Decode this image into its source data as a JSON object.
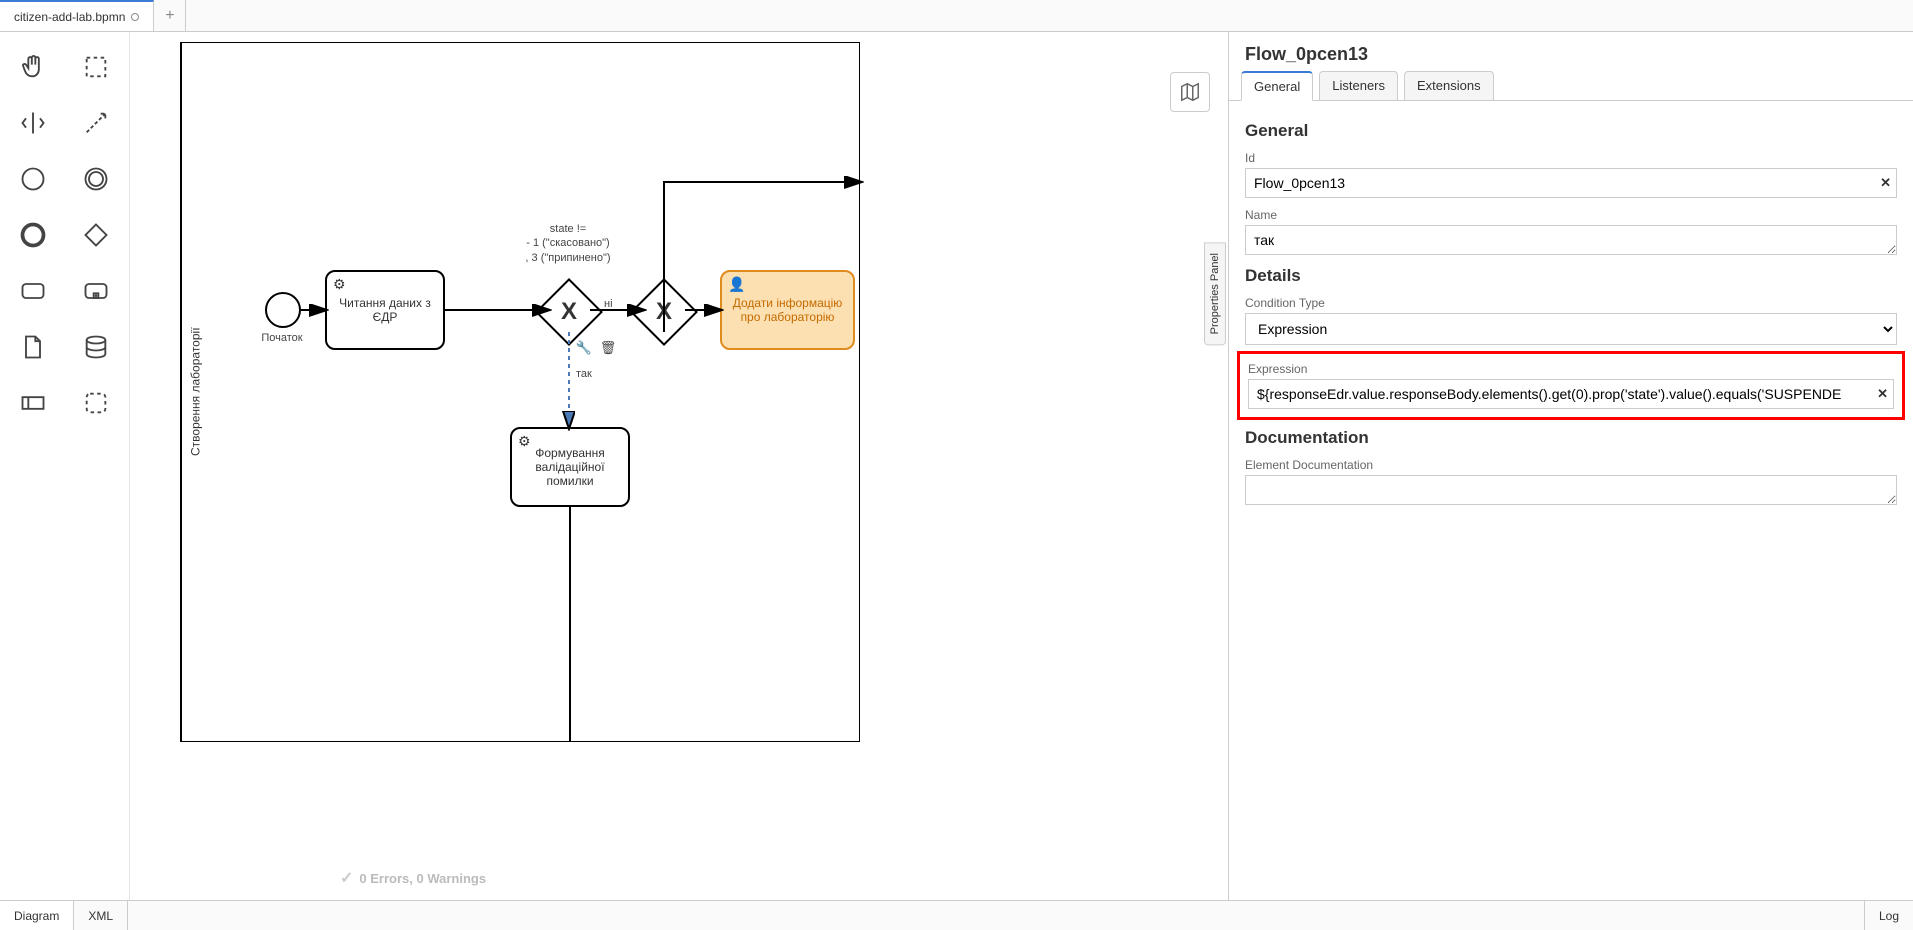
{
  "tabs": {
    "file_name": "citizen-add-lab.bpmn",
    "add": "+"
  },
  "canvas": {
    "pool_label": "Створення лабораторії",
    "start_label": "Початок",
    "task_read": "Читання даних з ЄДР",
    "gateway_note_line1": "state !=",
    "gateway_note_line2": "- 1 (\"скасовано\")",
    "gateway_note_line3": ", 3 (\"припинено\")",
    "flow_no": "ні",
    "flow_yes": "так",
    "task_user": "Додати інформацію про лабораторію",
    "task_error": "Формування валідаційної помилки",
    "validation": "0 Errors, 0 Warnings"
  },
  "props": {
    "toggle": "Properties Panel",
    "title": "Flow_0pcen13",
    "tabs": {
      "general": "General",
      "listeners": "Listeners",
      "extensions": "Extensions"
    },
    "group_general": "General",
    "id_label": "Id",
    "id_value": "Flow_0pcen13",
    "name_label": "Name",
    "name_value": "так",
    "group_details": "Details",
    "cond_type_label": "Condition Type",
    "cond_type_value": "Expression",
    "expr_label": "Expression",
    "expr_value": "${responseEdr.value.responseBody.elements().get(0).prop('state').value().equals('SUSPENDE",
    "group_doc": "Documentation",
    "doc_label": "Element Documentation",
    "doc_value": ""
  },
  "bottom": {
    "diagram": "Diagram",
    "xml": "XML",
    "log": "Log"
  }
}
